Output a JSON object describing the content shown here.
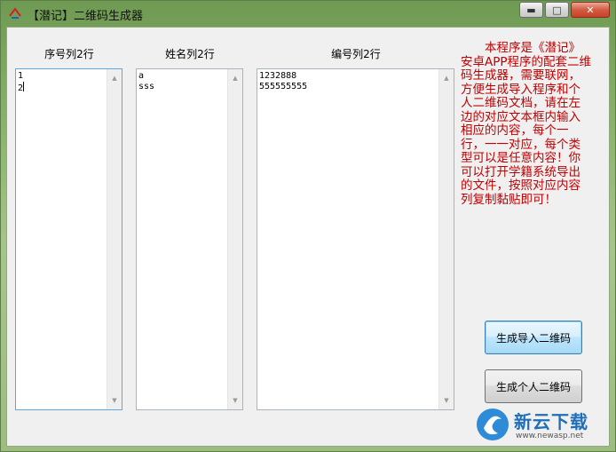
{
  "window": {
    "title": "【潜记】二维码生成器",
    "caption": {
      "minimize_glyph": "▬",
      "maximize_glyph": "□",
      "close_glyph": "✕"
    }
  },
  "columns": {
    "serial": {
      "label": "序号列2行",
      "value": "1\n2"
    },
    "name": {
      "label": "姓名列2行",
      "value": "a\nsss"
    },
    "number": {
      "label": "编号列2行",
      "value": "1232888\n555555555"
    }
  },
  "scroll_arrows": {
    "up": "▲",
    "down": "▼"
  },
  "info_text": "本程序是《潜记》安卓APP程序的配套二维码生成器，需要联网，方便生成导入程序和个人二维码文档，请在左边的对应文本框内输入相应的内容，每个一行，一一对应，每个类型可以是任意内容！你可以打开学籍系统导出的文件，按照对应内容列复制黏贴即可！",
  "buttons": {
    "generate_import": "生成导入二维码",
    "generate_personal": "生成个人二维码"
  },
  "watermark": {
    "brand": "新云下载",
    "url": "www.newasp.net"
  },
  "colors": {
    "info_text": "#c00000",
    "focus_border": "#5fa8de"
  }
}
